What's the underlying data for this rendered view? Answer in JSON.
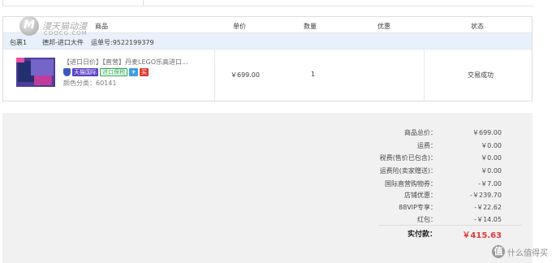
{
  "table_header": {
    "product": "商品",
    "unit_price": "单价",
    "quantity": "数量",
    "discount": "优惠",
    "status": "状态"
  },
  "package": {
    "name": "包裹1",
    "carrier": "德邦-进口大件",
    "tracking": "运单号:9522199379"
  },
  "item": {
    "title": "【进口日价】【直营】丹麦LEGO乐高进口...",
    "badge_tmall": "天猫国际",
    "badge_import": "进口保税",
    "badge_red": "买",
    "spec": "颜色分类：60141",
    "price": "￥699.00",
    "quantity": "1",
    "status": "交易成功"
  },
  "summary": [
    {
      "label": "商品总价：",
      "value": "￥699.00"
    },
    {
      "label": "运费：",
      "value": "￥0.00"
    },
    {
      "label": "税费(售价已包含)：",
      "value": "￥0.00"
    },
    {
      "label": "运费险(卖家赠送)：",
      "value": "￥0.00"
    },
    {
      "label": "国际直营购物券：",
      "value": "-￥7.00"
    },
    {
      "label": "店铺优惠：",
      "value": "-￥239.70"
    },
    {
      "label": "88VIP专享：",
      "value": "-￥22.62"
    },
    {
      "label": "红包：",
      "value": "-￥14.05"
    }
  ],
  "total": {
    "label": "实付款：",
    "value": "￥415.63"
  },
  "watermark": {
    "logo_letter": "M",
    "cn": "漫天猫动漫",
    "en": "CDOCG.COM"
  },
  "smzdm": {
    "logo_letter": "值",
    "text": "什么值得买"
  },
  "colors": {
    "accent_red": "#e4393c",
    "package_bar": "#e8f1fb",
    "summary_bg": "#f1f1f1"
  }
}
